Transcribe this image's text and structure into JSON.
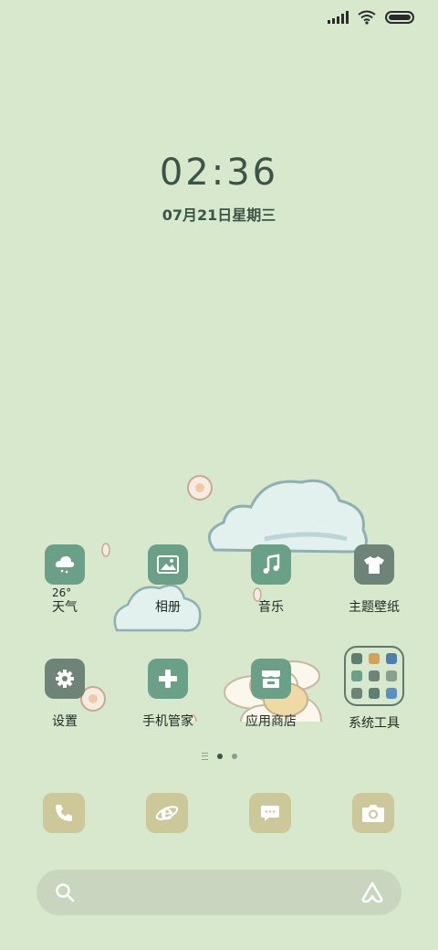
{
  "status_bar": {
    "signal_icon": "cellular-signal-icon",
    "wifi_icon": "wifi-icon",
    "battery_icon": "battery-icon"
  },
  "lockscreen": {
    "time": "02:36",
    "date": "07月21日星期三"
  },
  "weather": {
    "temperature": "26°"
  },
  "apps": [
    {
      "label": "天气",
      "icon": "weather-cloud-icon"
    },
    {
      "label": "相册",
      "icon": "photo-icon"
    },
    {
      "label": "音乐",
      "icon": "music-note-icon"
    },
    {
      "label": "主题壁纸",
      "icon": "tshirt-icon"
    },
    {
      "label": "设置",
      "icon": "gear-icon"
    },
    {
      "label": "手机管家",
      "icon": "plus-icon"
    },
    {
      "label": "应用商店",
      "icon": "store-icon"
    },
    {
      "label": "系统工具",
      "icon": "folder-icon"
    }
  ],
  "page_indicator": {
    "pages": 2,
    "current": 1
  },
  "dock": [
    {
      "icon": "phone-icon"
    },
    {
      "icon": "browser-icon"
    },
    {
      "icon": "message-icon"
    },
    {
      "icon": "camera-icon"
    }
  ],
  "search_bar": {
    "search_icon": "search-icon",
    "assistant_icon": "assistant-icon"
  },
  "colors": {
    "background": "#d7e8cd",
    "app_icon_green": "#6aa087",
    "app_icon_gray": "#6f8478",
    "dock_icon": "#cdc89a",
    "search_bar": "#c8d6bf"
  }
}
